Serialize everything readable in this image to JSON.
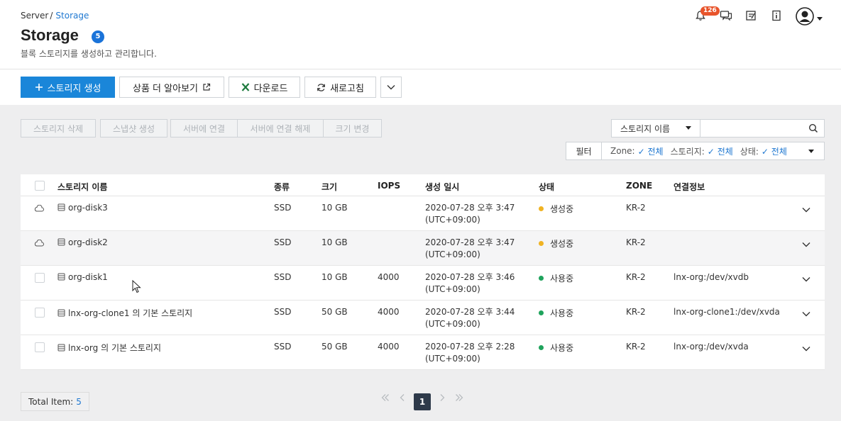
{
  "breadcrumb": {
    "root": "Server",
    "separator": "/",
    "current": "Storage"
  },
  "page": {
    "title": "Storage",
    "count": "5",
    "subtitle": "블록 스토리지를 생성하고 관리합니다."
  },
  "header": {
    "notification_count": "126"
  },
  "toolbar": {
    "create_label": "스토리지 생성",
    "learn_more_label": "상품 더 알아보기",
    "download_label": "다운로드",
    "refresh_label": "새로고침"
  },
  "actions": {
    "delete_label": "스토리지 삭제",
    "snapshot_label": "스냅샷 생성",
    "attach_label": "서버에 연결",
    "detach_label": "서버에 연결 해제",
    "resize_label": "크기 변경"
  },
  "search": {
    "field_label": "스토리지 이름",
    "value": ""
  },
  "filter": {
    "label": "필터",
    "zone_key": "Zone:",
    "zone_value": "전체",
    "storage_key": "스토리지:",
    "storage_value": "전체",
    "status_key": "상태:",
    "status_value": "전체"
  },
  "table": {
    "columns": {
      "name": "스토리지 이름",
      "type": "종류",
      "size": "크기",
      "iops": "IOPS",
      "created": "생성 일시",
      "status": "상태",
      "zone": "ZONE",
      "connection": "연결정보"
    },
    "rows": [
      {
        "name": "org-disk3",
        "type": "SSD",
        "size": "10 GB",
        "iops": "",
        "date": "2020-07-28 오후 3:47",
        "tz": "(UTC+09:00)",
        "status": "생성중",
        "status_color": "#f0b323",
        "zone": "KR-2",
        "connection": "",
        "creating": true
      },
      {
        "name": "org-disk2",
        "type": "SSD",
        "size": "10 GB",
        "iops": "",
        "date": "2020-07-28 오후 3:47",
        "tz": "(UTC+09:00)",
        "status": "생성중",
        "status_color": "#f0b323",
        "zone": "KR-2",
        "connection": "",
        "creating": true
      },
      {
        "name": "org-disk1",
        "type": "SSD",
        "size": "10 GB",
        "iops": "4000",
        "date": "2020-07-28 오후 3:46",
        "tz": "(UTC+09:00)",
        "status": "사용중",
        "status_color": "#1fa35c",
        "zone": "KR-2",
        "connection": "lnx-org:/dev/xvdb",
        "creating": false
      },
      {
        "name": "lnx-org-clone1 의 기본 스토리지",
        "type": "SSD",
        "size": "50 GB",
        "iops": "4000",
        "date": "2020-07-28 오후 3:44",
        "tz": "(UTC+09:00)",
        "status": "사용중",
        "status_color": "#1fa35c",
        "zone": "KR-2",
        "connection": "lnx-org-clone1:/dev/xvda",
        "creating": false
      },
      {
        "name": "lnx-org 의 기본 스토리지",
        "type": "SSD",
        "size": "50 GB",
        "iops": "4000",
        "date": "2020-07-28 오후 2:28",
        "tz": "(UTC+09:00)",
        "status": "사용중",
        "status_color": "#1fa35c",
        "zone": "KR-2",
        "connection": "lnx-org:/dev/xvda",
        "creating": false
      }
    ]
  },
  "footer": {
    "total_label": "Total Item:",
    "total_value": "5",
    "current_page": "1"
  },
  "colors": {
    "accent": "#1a86d9",
    "link": "#1f78d1",
    "creating": "#f0b323",
    "in_use": "#1fa35c",
    "badge": "#e8542b"
  }
}
